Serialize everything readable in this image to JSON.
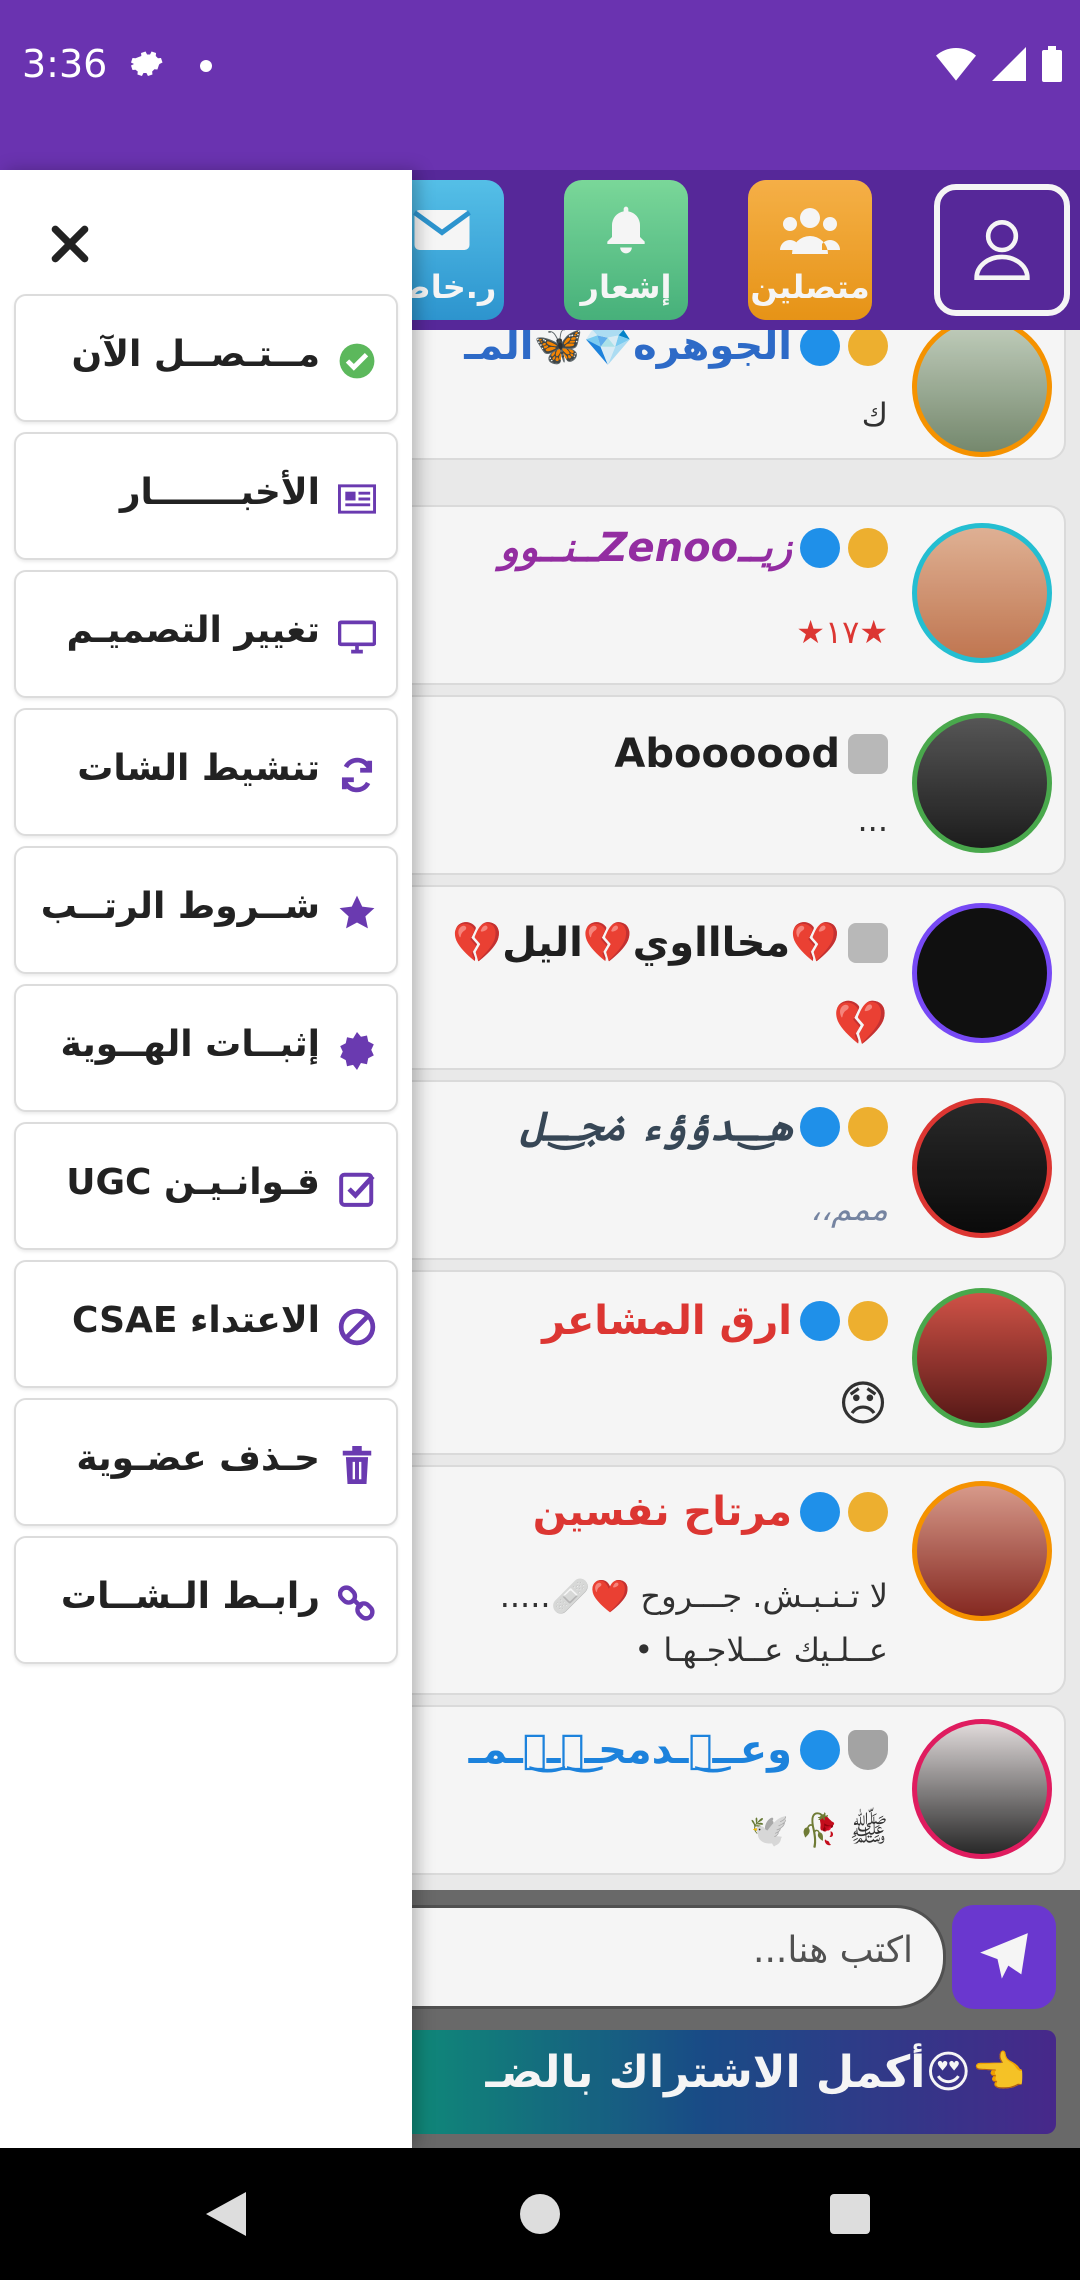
{
  "status_bar": {
    "time": "3:36"
  },
  "header": {
    "online_label": "متصلين",
    "notify_label": "إشعار",
    "private_label": "ر.خاص"
  },
  "drawer": {
    "items": [
      {
        "label": "مــتـصــل الآن",
        "icon": "check-circle-icon",
        "color": "#5cb85c"
      },
      {
        "label": "الأخبـــــــار",
        "icon": "newspaper-icon",
        "color": "#6a3ab0"
      },
      {
        "label": "تغيير التصميـم",
        "icon": "monitor-icon",
        "color": "#6a3ab0"
      },
      {
        "label": "تنشيط الشات",
        "icon": "refresh-icon",
        "color": "#6a3ab0"
      },
      {
        "label": "شــروط الرتــب",
        "icon": "star-icon",
        "color": "#6a3ab0"
      },
      {
        "label": "إثبــات الهــوية",
        "icon": "cert-icon",
        "color": "#6a3ab0"
      },
      {
        "label": "قـوانـيـن UGC",
        "icon": "checkbox-icon",
        "color": "#6a3ab0"
      },
      {
        "label": "الاعتداء CSAE",
        "icon": "ban-icon",
        "color": "#6a3ab0"
      },
      {
        "label": "حـذف عضـوية",
        "icon": "trash-icon",
        "color": "#6a3ab0"
      },
      {
        "label": "رابـط الـشــات",
        "icon": "link-icon",
        "color": "#6a3ab0"
      }
    ]
  },
  "chats": [
    {
      "name": "الجوهره💎🦋المـ",
      "msg": "ك",
      "name_color": "#2f6fd0"
    },
    {
      "name": "زيــZenooــنــوو",
      "msg": "★١٧★",
      "name_color": "#9a2fa8"
    },
    {
      "name": "Aboooood",
      "msg": "...",
      "name_color": "#222222"
    },
    {
      "name": "💔مخاااوي💔اليل💔",
      "msg": "💔",
      "name_color": "#222222"
    },
    {
      "name": "هـ͜ـدؤؤء ݥجـ͜ـل",
      "msg": "ممم،،",
      "name_color": "#3a4a5a"
    },
    {
      "name": "ارق المشاعر",
      "msg": "😞",
      "name_color": "#e53935"
    },
    {
      "name": "مرتاح نفسين",
      "msg": "لا تـنـبـش. جـــروح ❤️🩹.....",
      "msg2": "عــلـيك عــلاجـهـا •",
      "name_color": "#e53935"
    },
    {
      "name": "وعــ๋͜ـدمحـ๋͜ـ๋͜ـمـ",
      "msg": "ﷺ 🥀 🕊️",
      "name_color": "#1e88e5"
    }
  ],
  "input": {
    "placeholder": "اكتب هنا..."
  },
  "promo": {
    "text": "👈😍أكمل الاشتراك بالضـ"
  }
}
